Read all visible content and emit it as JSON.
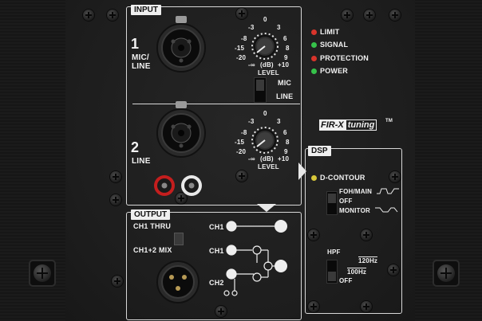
{
  "input": {
    "section_label": "INPUT",
    "ch1_number": "1",
    "ch1_label_line1": "MIC/",
    "ch1_label_line2": "LINE",
    "ch2_number": "2",
    "ch2_label": "LINE",
    "level_scale_left": [
      "-3",
      "-8",
      "-15",
      "-20",
      "-∞"
    ],
    "level_scale_top": "0",
    "level_scale_right": [
      "3",
      "6",
      "8",
      "9",
      "+10"
    ],
    "level_unit": "(dB)",
    "level_label": "LEVEL",
    "mic_line_switch": {
      "top": "MIC",
      "bottom": "LINE"
    }
  },
  "indicators": [
    {
      "label": "LIMIT",
      "color": "#d9342b"
    },
    {
      "label": "SIGNAL",
      "color": "#36c24a"
    },
    {
      "label": "PROTECTION",
      "color": "#d9342b"
    },
    {
      "label": "POWER",
      "color": "#36c24a"
    }
  ],
  "brand": {
    "logo_left": "FIR-X",
    "logo_right": "tuning",
    "trademark": "TM"
  },
  "dsp": {
    "section_label": "DSP",
    "d_contour_label": "D-CONTOUR",
    "d_contour_led_color": "#d8c83a",
    "d_contour_options": [
      "FOH/MAIN",
      "OFF",
      "MONITOR"
    ],
    "hpf_label": "HPF",
    "hpf_options": [
      "120Hz",
      "100Hz",
      "OFF"
    ]
  },
  "output": {
    "section_label": "OUTPUT",
    "ch1_thru_label": "CH1 THRU",
    "ch1_2_mix_label": "CH1+2 MIX",
    "diagram_ch1_top": "CH1",
    "diagram_ch1_mix": "CH1",
    "diagram_ch2_mix": "CH2"
  },
  "colors": {
    "panel": "#1d1d1d",
    "line": "#d8d8d8",
    "led_red": "#d9342b",
    "led_green": "#36c24a",
    "rca_red": "#c41e1e",
    "rca_white": "#e8e8e8"
  }
}
